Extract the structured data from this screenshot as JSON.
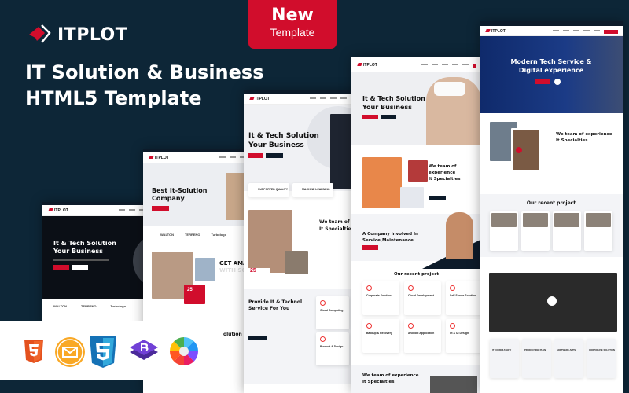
{
  "brand": {
    "name": "ITPLOT",
    "accent": "#d10d2c",
    "background": "#0d2637"
  },
  "headline": {
    "line1": "IT Solution & Business",
    "line2": "HTML5 Template"
  },
  "badge": {
    "line1": "New",
    "line2": "Template"
  },
  "mockups": {
    "m1": {
      "logo": "ITPLOT",
      "hero_line1": "It & Tech Solution",
      "hero_line2": "Your Business",
      "partners": [
        "WALTON",
        "TERRENO",
        "Turbologo"
      ]
    },
    "m2": {
      "logo": "ITPLOT",
      "hero_line1": "Best It-Solution",
      "hero_line2": "Company",
      "partners": [
        "WALTON",
        "TERRENO",
        "Turbologo"
      ],
      "section_line1": "GET AMAZIN",
      "section_line2": "WITH SOLUT",
      "years": "25.",
      "bottom_heading": "olution"
    },
    "m3": {
      "logo": "ITPLOT",
      "hero_line1": "It & Tech Solution",
      "hero_line2": "Your Business",
      "features": [
        "SUPPORTED QUALITY",
        "MACHINE LEARNING"
      ],
      "about_line1": "We team of exp",
      "about_line2": "It Specialties",
      "years": "25",
      "service_line1": "Provide It & Technol",
      "service_line2": "Service For You",
      "service_cards": [
        "Cloud Computing",
        "Product & Design"
      ]
    },
    "m4": {
      "logo": "ITPLOT",
      "hero_line1": "It & Tech Solution",
      "hero_line2": "Your Business",
      "about_line1": "We team of experience",
      "about_line2": "It Specialties",
      "company_line1": "A Company involved In",
      "company_line2": "Service,Maintenance",
      "projects_heading": "Our recent project",
      "project_cards": [
        "Corporate Solution",
        "Cloud Development",
        "Self Server Solution",
        "Backup & Recovery",
        "Android Application",
        "UI & UI Design"
      ],
      "bottom_line1": "We team of experience",
      "bottom_line2": "It Specialties"
    },
    "m5": {
      "logo": "ITPLOT",
      "hero_line1": "Modern Tech Service &",
      "hero_line2": "Digital experience",
      "about_line1": "We team of experience",
      "about_line2": "It Specialties",
      "projects_heading": "Our recent project",
      "steps": [
        "IT CONSULTANCY",
        "PRODUCTING PLAN",
        "SOFTWARE APPS",
        "CORPORATE SOLUTION"
      ]
    }
  },
  "tech_icons": [
    "html5-icon",
    "mail-icon",
    "css3-icon",
    "bootstrap-icon",
    "color-wheel-icon"
  ]
}
